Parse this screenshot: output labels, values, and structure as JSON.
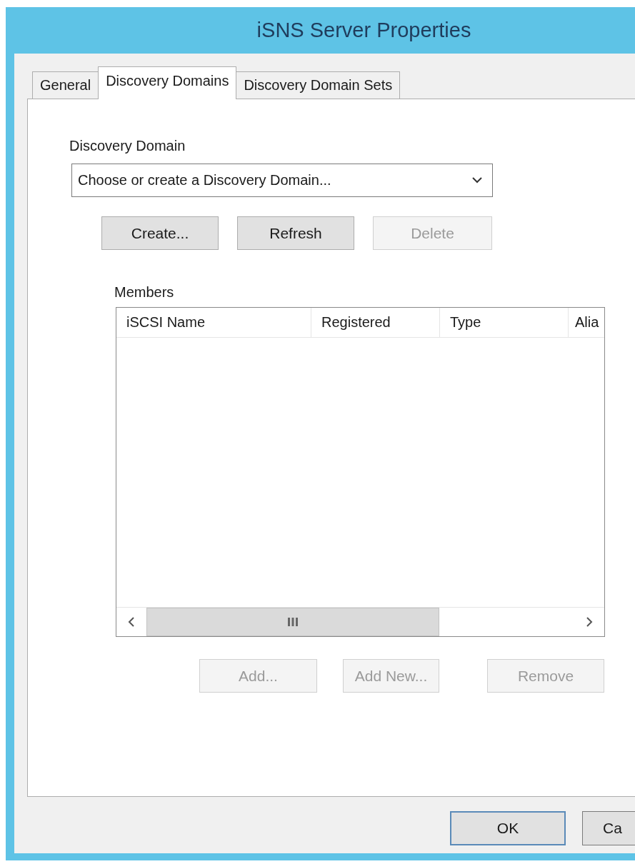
{
  "window": {
    "title": "iSNS Server Properties"
  },
  "tabs": [
    {
      "label": "General",
      "selected": false
    },
    {
      "label": "Discovery Domains",
      "selected": true
    },
    {
      "label": "Discovery Domain Sets",
      "selected": false
    }
  ],
  "discovery_domain": {
    "label": "Discovery Domain",
    "value": "Choose or create a Discovery Domain..."
  },
  "domain_buttons": [
    {
      "label": "Create...",
      "disabled": false
    },
    {
      "label": "Refresh",
      "disabled": false
    },
    {
      "label": "Delete",
      "disabled": true
    }
  ],
  "members": {
    "label": "Members",
    "columns": [
      "iSCSI Name",
      "Registered",
      "Type",
      "Alia"
    ]
  },
  "member_buttons": [
    {
      "label": "Add...",
      "disabled": true
    },
    {
      "label": "Add New...",
      "disabled": true
    },
    {
      "label": "Remove",
      "disabled": true
    }
  ],
  "dialog_buttons": [
    {
      "label": "OK",
      "kind": "default"
    },
    {
      "label": "Ca",
      "kind": "cut"
    }
  ]
}
